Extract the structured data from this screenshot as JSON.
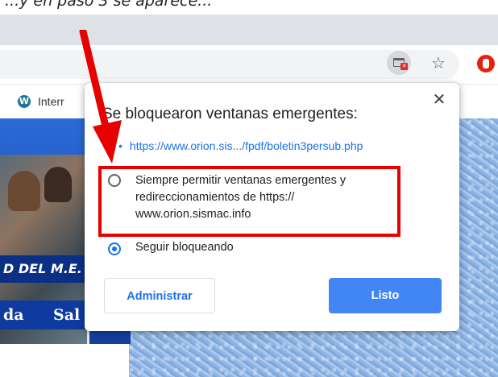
{
  "caption": "...y en paso 3 se aparece...",
  "bookmarks": {
    "item1_label": "Interr"
  },
  "page": {
    "banner_strip_text": "D DEL M.E.",
    "banner_nav_left": "da",
    "banner_nav_right": "Sal"
  },
  "popup": {
    "title": "Se bloquearon ventanas emergentes:",
    "blocked_link": "https://www.orion.sis.../fpdf/boletin3persub.php",
    "allow_option": "Siempre permitir ventanas emergentes y redireccionamientos de https:// www.orion.sismac.info",
    "block_option": "Seguir bloqueando",
    "manage_button": "Administrar",
    "done_button": "Listo",
    "selected_option": "block"
  },
  "icons": {
    "popup_blocked": "popup-blocked-icon",
    "bookmark_star": "star-icon",
    "extension": "extension-icon",
    "close": "close-icon",
    "wordpress": "wordpress-icon"
  },
  "colors": {
    "accent": "#1a73e8",
    "primary_button": "#4285f4",
    "annotation": "#e60000"
  }
}
